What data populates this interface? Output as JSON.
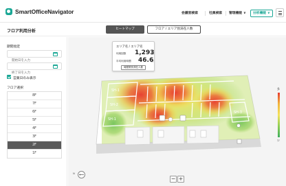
{
  "app": {
    "name": "SmartOfficeNavigator"
  },
  "topnav": {
    "items": [
      "会議室検索",
      "社員検索",
      "管理機能",
      "分析機能"
    ],
    "dropdown_glyph": "∨",
    "menu_icon": "hamburger-icon"
  },
  "page": {
    "title": "フロア利用分析"
  },
  "tabs": {
    "heatmap": "ヒートマップ",
    "floor_area": "フロア / エリア別滞在人数"
  },
  "sidebar": {
    "period_label": "期間指定",
    "start_placeholder": "開始日を入力",
    "end_placeholder": "終了日を入力",
    "business_days_label": "営業日のみ表示",
    "business_days_checked": true,
    "floor_label": "フロア選択",
    "floors": [
      "8F",
      "7F",
      "6F",
      "5F",
      "4F",
      "3F",
      "2F",
      "1F"
    ],
    "selected_floor": "2F"
  },
  "tooltip": {
    "title": "エリア名 / エリア名",
    "stay_label": "利用回数",
    "stay_value": "1,293",
    "stay_unit": "回",
    "avg_label": "平均利用時間",
    "avg_value": "46.6",
    "avg_unit": "分",
    "detail_button": "時間帯別滞在人数"
  },
  "map_labels": [
    "SH-1",
    "SH-2",
    "SH-1",
    "SH-3"
  ],
  "legend": {
    "max": "多",
    "min": "少",
    "colors": [
      "#e83a2e",
      "#f1b53b",
      "#f4e25c",
      "#8fce55",
      "#3fae5c"
    ]
  },
  "zoom": {
    "minus": "−",
    "plus": "+"
  },
  "compass_label": "N"
}
